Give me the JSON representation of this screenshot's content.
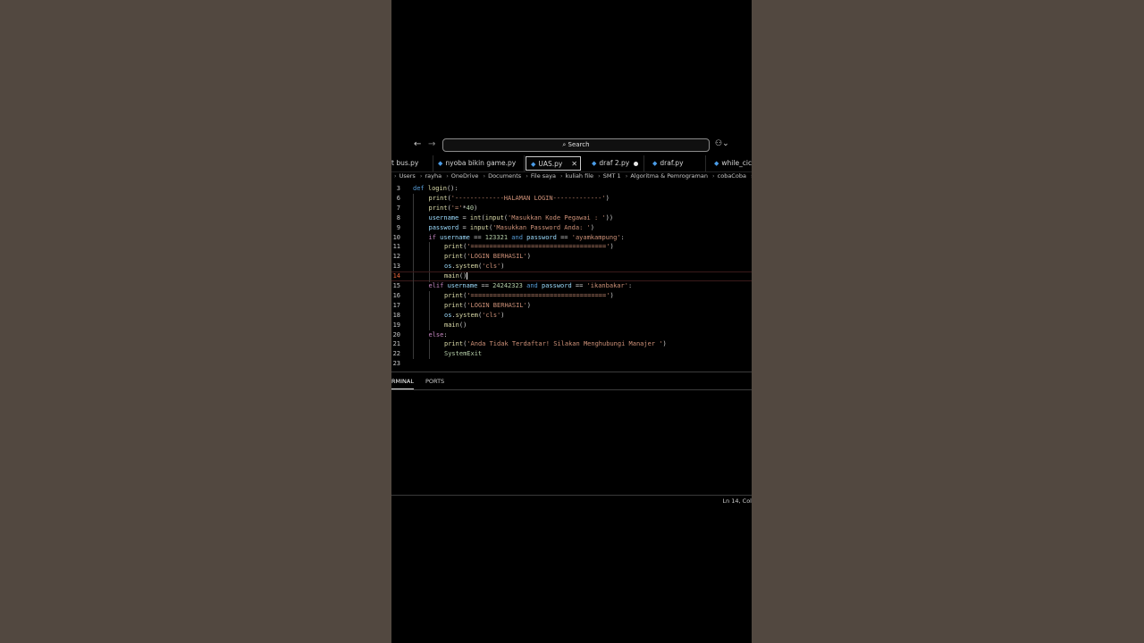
{
  "titlebar": {
    "back_icon": "arrow-left-icon",
    "forward_icon": "arrow-right-icon",
    "search_placeholder": "Search",
    "search_icon": "search-icon",
    "copilot_icon": "copilot-icon"
  },
  "tabs": [
    {
      "label": "t bus.py",
      "active": false
    },
    {
      "label": "nyoba bikin game.py",
      "active": false
    },
    {
      "label": "UAS.py",
      "active": true
    },
    {
      "label": "draf 2.py",
      "active": false,
      "modified": true
    },
    {
      "label": "draf.py",
      "active": false
    },
    {
      "label": "while_cici",
      "active": false
    }
  ],
  "breadcrumb": [
    "Users",
    "rayha",
    "OneDrive",
    "Documents",
    "File saya",
    "kuliah file",
    "SMT 1",
    "Algoritma & Pemrograman",
    "cobaCoba"
  ],
  "editor": {
    "current_line": "14",
    "lines": [
      {
        "n": "3",
        "code": "def login():"
      },
      {
        "n": "6",
        "code": "print('-------------HALAMAN LOGIN-------------')"
      },
      {
        "n": "7",
        "code": "print('='*40)"
      },
      {
        "n": "8",
        "code": "username = int(input('Masukkan Kode Pegawai : '))"
      },
      {
        "n": "9",
        "code": "password = input('Masukkan Password Anda: ')"
      },
      {
        "n": "10",
        "code": "if username == 123321 and password == 'ayamkampung':"
      },
      {
        "n": "11",
        "code": "print('====================================')"
      },
      {
        "n": "12",
        "code": "print('LOGIN BERHASIL')"
      },
      {
        "n": "13",
        "code": "os.system('cls')"
      },
      {
        "n": "14",
        "code": "main()"
      },
      {
        "n": "15",
        "code": "elif username == 24242323 and password == 'ikanbakar':"
      },
      {
        "n": "16",
        "code": "print('====================================')"
      },
      {
        "n": "17",
        "code": "print('LOGIN BERHASIL')"
      },
      {
        "n": "18",
        "code": "os.system('cls')"
      },
      {
        "n": "19",
        "code": "main()"
      },
      {
        "n": "20",
        "code": "else:"
      },
      {
        "n": "21",
        "code": "print('Anda Tidak Terdaftar! Silakan Menghubungi Manajer ')"
      },
      {
        "n": "22",
        "code": "SystemExit"
      },
      {
        "n": "23",
        "code": ""
      }
    ]
  },
  "panel": {
    "tabs": [
      "RMINAL",
      "PORTS"
    ],
    "active_tab": "RMINAL"
  },
  "statusbar": {
    "position": "Ln 14, Col"
  },
  "colors": {
    "keyword": "#569cd6",
    "function": "#dcdcaa",
    "string": "#ce9178",
    "number": "#b5cea8",
    "variable": "#9cdcfe",
    "control": "#c586c0",
    "current_line_number": "#e8633a"
  }
}
